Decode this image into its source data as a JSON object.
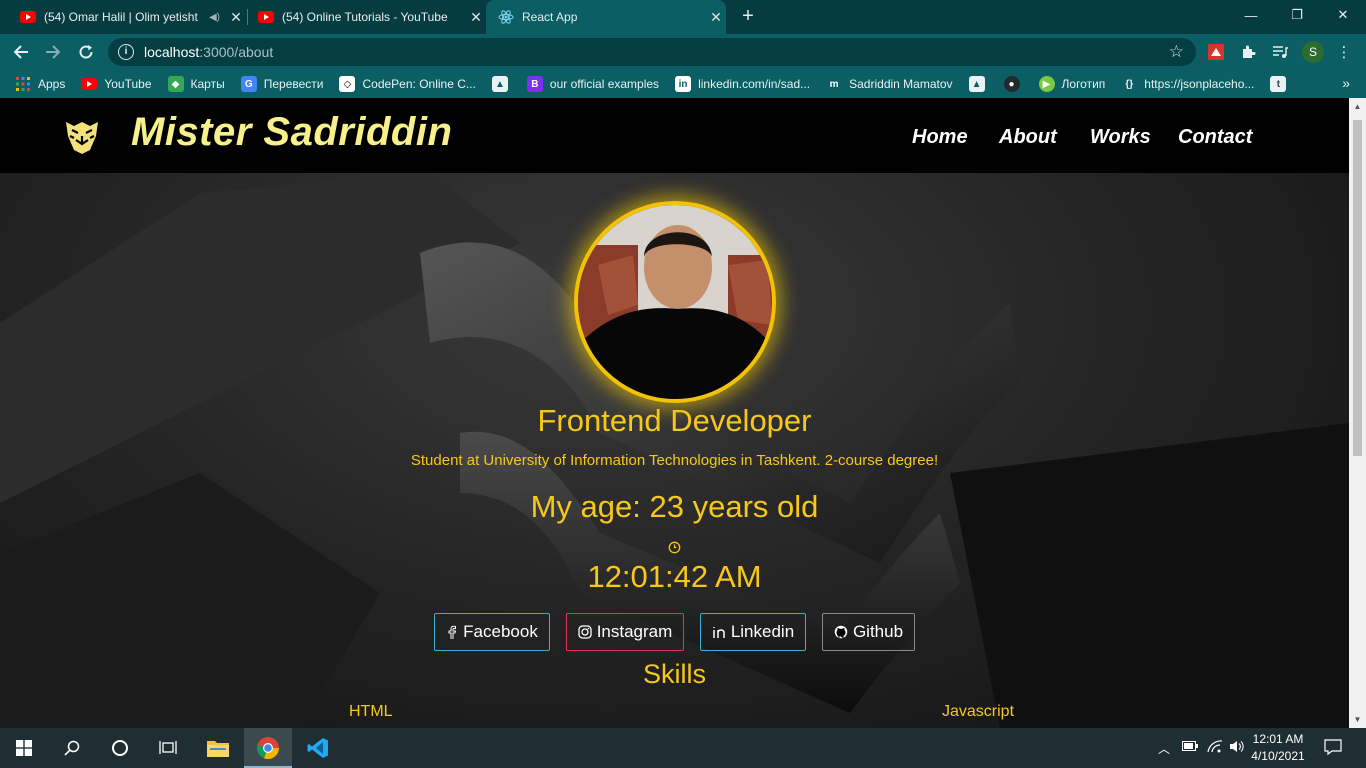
{
  "browser": {
    "tabs": [
      {
        "title": "(54) Omar Halil | Olim yetisht",
        "favicon": "youtube-icon",
        "muted": true
      },
      {
        "title": "(54) Online Tutorials - YouTube",
        "favicon": "youtube-icon"
      },
      {
        "title": "React App",
        "favicon": "react-icon",
        "active": true
      }
    ],
    "new_tab": "+",
    "url_host": "localhost",
    "url_path": ":3000/about",
    "profile_initial": "S",
    "bookmarks": [
      {
        "label": "Apps",
        "icon": "apps-grid-icon"
      },
      {
        "label": "YouTube",
        "icon": "youtube-icon"
      },
      {
        "label": "Карты",
        "icon": "maps-icon"
      },
      {
        "label": "Перевести",
        "icon": "translate-icon"
      },
      {
        "label": "CodePen: Online C...",
        "icon": "codepen-icon"
      },
      {
        "label": "",
        "icon": "bookmark-icon"
      },
      {
        "label": "our official examples",
        "icon": "bootstrap-icon"
      },
      {
        "label": "linkedin.com/in/sad...",
        "icon": "linkedin-icon"
      },
      {
        "label": "Sadriddin Mamatov",
        "icon": "mozilla-icon"
      },
      {
        "label": "",
        "icon": "bookmark-icon"
      },
      {
        "label": "",
        "icon": "github-icon"
      },
      {
        "label": "Логотип",
        "icon": "play-icon"
      },
      {
        "label": "https://jsonplaceho...",
        "icon": "globe-icon"
      },
      {
        "label": "",
        "icon": "tumblr-icon"
      }
    ]
  },
  "site": {
    "brand": "Mister Sadriddin",
    "nav": [
      "Home",
      "About",
      "Works",
      "Contact"
    ],
    "role": "Frontend Developer",
    "study": "Student at University of Information Technologies in Tashkent. 2-course degree!",
    "age": "My age: 23 years old",
    "time": "12:01:42 AM",
    "socials": [
      {
        "label": "Facebook",
        "icon": "facebook-icon",
        "color": "#3ab0d9"
      },
      {
        "label": "Instagram",
        "icon": "instagram-icon",
        "color": "#e3344a"
      },
      {
        "label": "Linkedin",
        "icon": "linkedin-icon",
        "color": "#3ab0d9"
      },
      {
        "label": "Github",
        "icon": "github-icon",
        "color": "#8a8a8a"
      }
    ],
    "skills_title": "Skills",
    "skills": [
      "HTML",
      "Javascript"
    ],
    "accent": "#f6c81a"
  },
  "taskbar": {
    "time": "12:01 AM",
    "date": "4/10/2021"
  }
}
